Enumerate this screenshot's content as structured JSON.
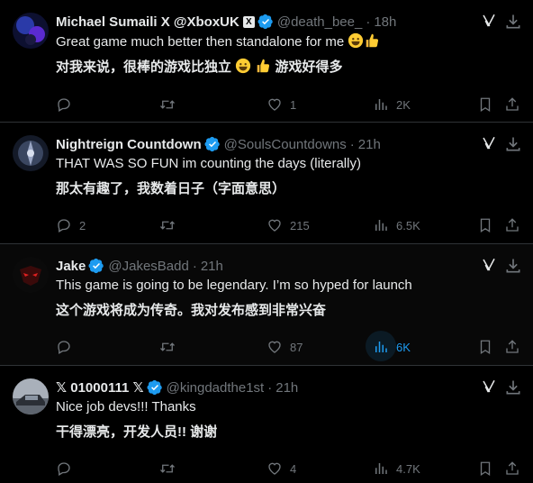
{
  "tweets": [
    {
      "name": "Michael Sumaili X @XboxUK",
      "has_x_badge": true,
      "handle": "@death_bee_",
      "time": "18h",
      "text1": "Great game much better then standalone for me",
      "text2": "对我来说，很棒的游戏比独立",
      "text2_suffix": "游戏好得多",
      "replies": "",
      "retweets": "",
      "likes": "1",
      "views": "2K"
    },
    {
      "name": "Nightreign Countdown",
      "handle": "@SoulsCountdowns",
      "time": "21h",
      "text1": "THAT WAS SO FUN im counting the days (literally)",
      "text2": "那太有趣了，我数着日子（字面意思）",
      "replies": "2",
      "retweets": "",
      "likes": "215",
      "views": "6.5K"
    },
    {
      "name": "Jake",
      "handle": "@JakesBadd",
      "time": "21h",
      "text1": "This game is going to be legendary. I’m so hyped for launch",
      "text2": "这个游戏将成为传奇。我对发布感到非常兴奋",
      "replies": "",
      "retweets": "",
      "likes": "87",
      "views": "6K"
    },
    {
      "name": "𝕏 01000111 𝕏",
      "handle": "@kingdadthe1st",
      "time": "21h",
      "text1": "Nice job devs!!! Thanks",
      "text2": "干得漂亮，开发人员!! 谢谢",
      "replies": "",
      "retweets": "",
      "likes": "4",
      "views": "4.7K"
    }
  ],
  "colors": {
    "background": "#000000",
    "text": "#e7e9ea",
    "muted": "#71767b",
    "accent": "#1d9bf0",
    "divider": "#2f3336"
  },
  "icons": [
    "verified-badge-icon",
    "grok-icon",
    "more-icon",
    "reply-icon",
    "retweet-icon",
    "like-icon",
    "views-icon",
    "bookmark-icon",
    "share-icon",
    "grinning-face-emoji",
    "thumbs-up-emoji"
  ]
}
